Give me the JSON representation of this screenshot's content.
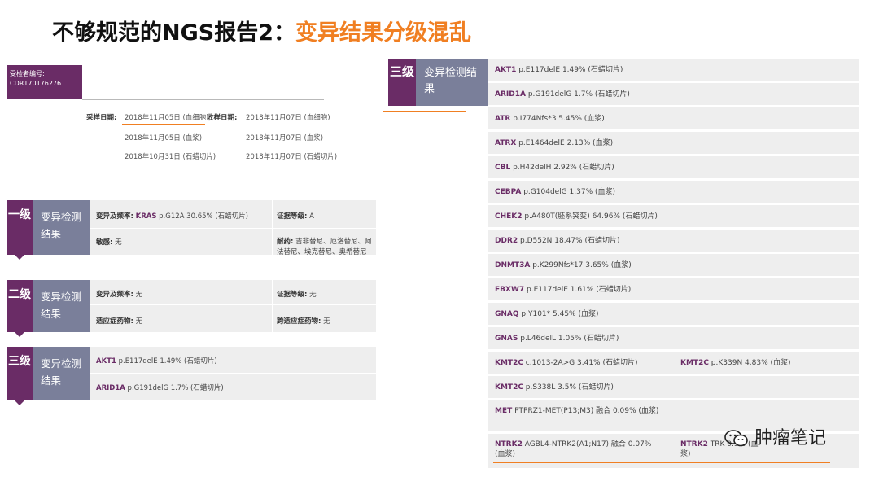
{
  "title": {
    "part1": "不够规范的NGS报告2：",
    "part2": "变异结果分级混乱"
  },
  "patient": {
    "id_label": "受检者编号:",
    "id_value": "CDR170176276"
  },
  "dates": {
    "sample_label": "采样日期:",
    "receive_label": "收样日期:",
    "rows": [
      {
        "sample": "2018年11月05日 (血细胞)",
        "receive": "2018年11月07日 (血细胞)"
      },
      {
        "sample": "2018年11月05日 (血浆)",
        "receive": "2018年11月07日 (血浆)"
      },
      {
        "sample": "2018年10月31日 (石蜡切片)",
        "receive": "2018年11月07日 (石蜡切片)"
      }
    ]
  },
  "level1": {
    "tag": "一级",
    "label": "变异检测结果",
    "mut_label": "变异及频率:",
    "mut_gene": "KRAS",
    "mut_value": " p.G12A 30.65% (石蜡切片)",
    "evidence_label": "证据等级:",
    "evidence_value": "A",
    "sensitive_label": "敏感:",
    "sensitive_value": "无",
    "resist_label": "耐药:",
    "resist_value": "吉非替尼、厄洛替尼、阿法替尼、埃克替尼、奥希替尼"
  },
  "level2": {
    "tag": "二级",
    "label": "变异检测结果",
    "mut_label": "变异及频率:",
    "mut_value": "无",
    "evidence_label": "证据等级:",
    "evidence_value": "无",
    "indic_label": "适应症药物:",
    "indic_value": "无",
    "cross_label": "跨适应症药物:",
    "cross_value": "无"
  },
  "level3_left": {
    "tag": "三级",
    "label": "变异检测结果",
    "items": [
      {
        "gene": "AKT1",
        "detail": " p.E117delE 1.49% (石蜡切片)"
      },
      {
        "gene": "ARID1A",
        "detail": " p.G191delG 1.7% (石蜡切片)"
      }
    ]
  },
  "level3_right": {
    "tag": "三级",
    "label": "变异检测结果",
    "rows": [
      [
        {
          "gene": "AKT1",
          "detail": " p.E117delE 1.49% (石蜡切片)"
        }
      ],
      [
        {
          "gene": "ARID1A",
          "detail": " p.G191delG 1.7% (石蜡切片)"
        }
      ],
      [
        {
          "gene": "ATR",
          "detail": " p.I774Nfs*3 5.45% (血浆)"
        }
      ],
      [
        {
          "gene": "ATRX",
          "detail": " p.E1464delE 2.13% (血浆)"
        }
      ],
      [
        {
          "gene": "CBL",
          "detail": " p.H42delH 2.92% (石蜡切片)"
        }
      ],
      [
        {
          "gene": "CEBPA",
          "detail": " p.G104delG 1.37% (血浆)"
        }
      ],
      [
        {
          "gene": "CHEK2",
          "detail": " p.A480T(胚系突变) 64.96% (石蜡切片)"
        }
      ],
      [
        {
          "gene": "DDR2",
          "detail": " p.D552N 18.47% (石蜡切片)"
        }
      ],
      [
        {
          "gene": "DNMT3A",
          "detail": " p.K299Nfs*17 3.65% (血浆)"
        }
      ],
      [
        {
          "gene": "FBXW7",
          "detail": " p.E117delE 1.61% (石蜡切片)"
        }
      ],
      [
        {
          "gene": "GNAQ",
          "detail": " p.Y101* 5.45% (血浆)"
        }
      ],
      [
        {
          "gene": "GNAS",
          "detail": " p.L46delL 1.05% (石蜡切片)"
        }
      ],
      [
        {
          "gene": "KMT2C",
          "detail": " c.1013-2A>G 3.41% (石蜡切片)"
        },
        {
          "gene": "KMT2C",
          "detail": " p.K339N 4.83% (血浆)"
        }
      ],
      [
        {
          "gene": "KMT2C",
          "detail": " p.S338L 3.5% (石蜡切片)"
        }
      ],
      [
        {
          "gene": "MET",
          "detail": " PTPRZ1-MET(P13;M3) 融合 0.09% (血浆)"
        }
      ],
      [
        {
          "gene": "NTRK2",
          "detail": " AGBL4-NTRK2(A1;N17) 融合 0.07% (血浆)"
        },
        {
          "gene": "NTRK2",
          "detail": " TRK 0.9% (血浆)"
        }
      ]
    ]
  },
  "watermark": {
    "text": "肿瘤笔记",
    "icon": "wechat-icon"
  },
  "colors": {
    "purple": "#6a2c66",
    "slate": "#7a7f9a",
    "orange": "#f07f22",
    "gray": "#eeeeee"
  }
}
